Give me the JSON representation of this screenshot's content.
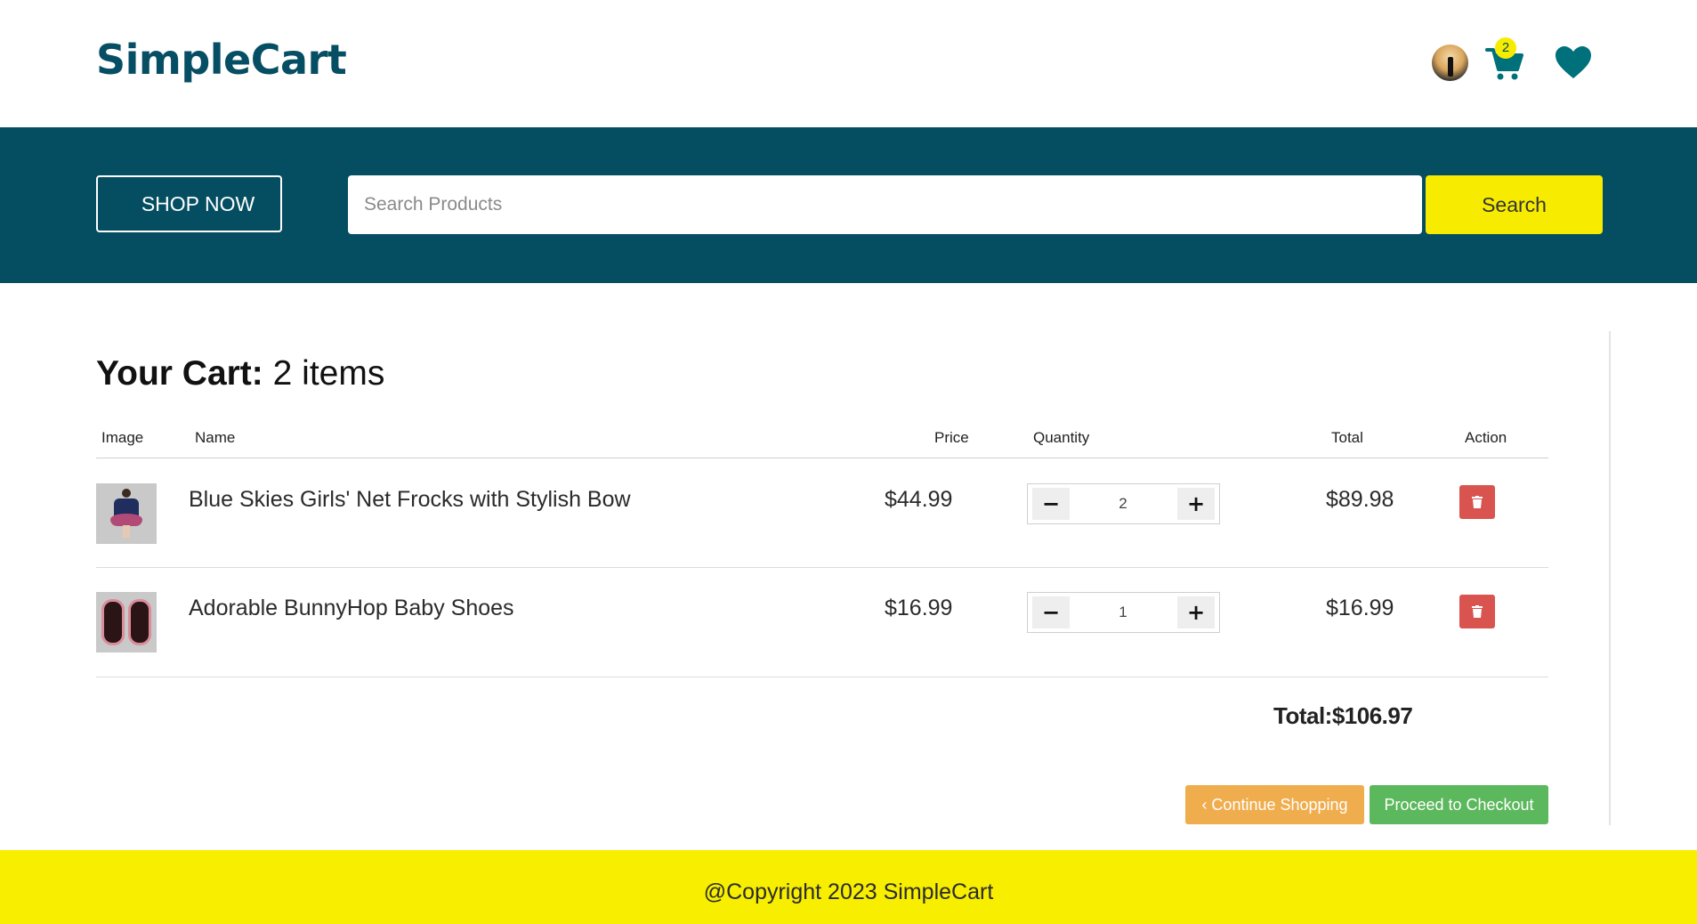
{
  "header": {
    "brand": "SimpleCart",
    "cart_count": "2",
    "icons": [
      "user-avatar",
      "shopping-cart-icon",
      "heart-icon"
    ]
  },
  "banner": {
    "shop_now_label": "SHOP NOW",
    "search_placeholder": "Search Products",
    "search_value": "",
    "search_button_label": "Search"
  },
  "cart": {
    "heading_label": "Your Cart:",
    "heading_count": "2 items",
    "columns": [
      "Image",
      "Name",
      "Price",
      "Quantity",
      "Total",
      "Action"
    ],
    "items": [
      {
        "name": "Blue Skies Girls' Net Frocks with Stylish Bow",
        "price": "$44.99",
        "quantity": "2",
        "total": "$89.98",
        "decrement_label": "−",
        "increment_label": "+"
      },
      {
        "name": "Adorable BunnyHop Baby Shoes",
        "price": "$16.99",
        "quantity": "1",
        "total": "$16.99",
        "decrement_label": "−",
        "increment_label": "+"
      }
    ],
    "grand_total": "Total:$106.97",
    "continue_label": "‹ Continue Shopping",
    "checkout_label": "Proceed to Checkout"
  },
  "footer": {
    "copyright": "@Copyright 2023 SimpleCart"
  },
  "colors": {
    "brand": "#064e63",
    "banner": "#054e62",
    "accent_yellow": "#f7ec00",
    "danger": "#d9534f",
    "warning": "#f0ad4e",
    "success": "#5cb85c"
  }
}
